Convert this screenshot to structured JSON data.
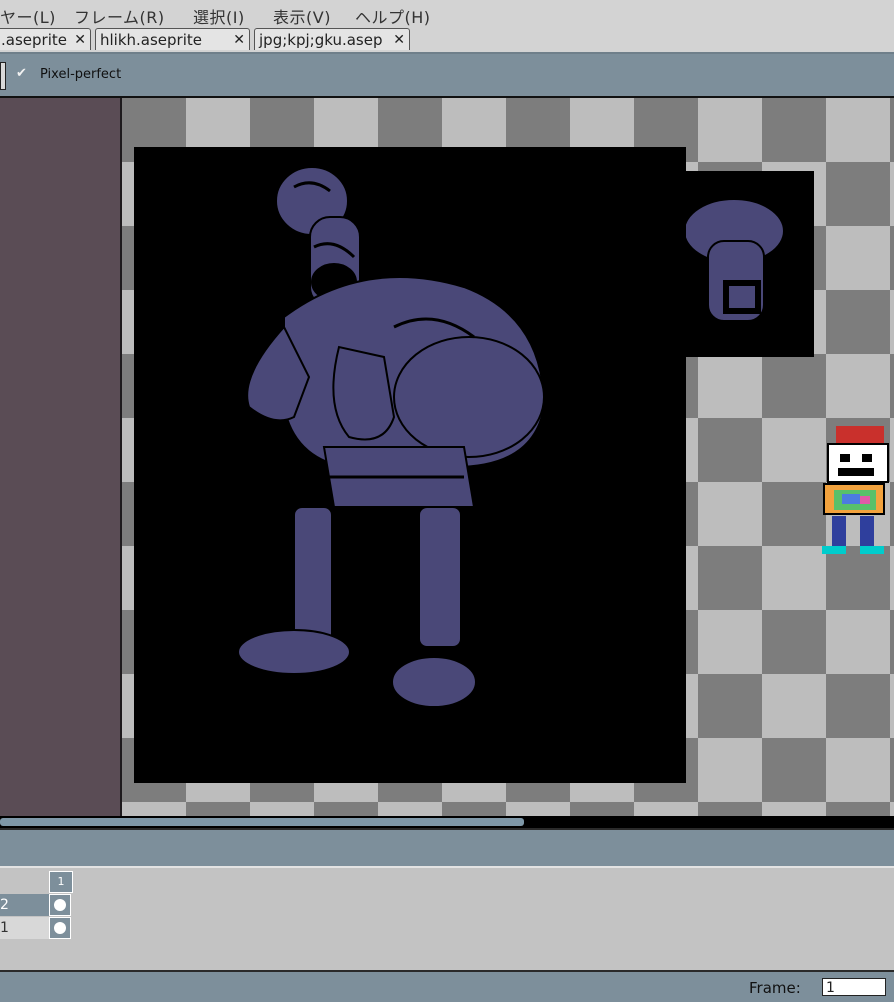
{
  "menubar": {
    "items": [
      "ヤー(L)",
      "フレーム(R)",
      "選択(I)",
      "表示(V)",
      "ヘルプ(H)"
    ]
  },
  "tabs": [
    {
      "label": ".aseprite",
      "close": "✕"
    },
    {
      "label": "hlikh.aseprite",
      "close": "✕"
    },
    {
      "label": "jpg;kpj;gku.asep",
      "close": "✕"
    }
  ],
  "contextbar": {
    "pixel_perfect_label": "Pixel-perfect",
    "pixel_perfect_checked": true
  },
  "timeline": {
    "frame_header": "1",
    "layers": [
      {
        "name": "2",
        "selected": true
      },
      {
        "name": "1",
        "selected": false
      }
    ]
  },
  "statusbar": {
    "frame_label": "Frame:",
    "frame_value": "1"
  },
  "colors": {
    "menubar_bg": "#d3d3d3",
    "panel_blue_gray": "#7d8f9b",
    "sprite_purple": "#4a4878",
    "sprite_bg": "#000000",
    "left_pane": "#5a4c55",
    "checker_dark": "#7d7d7d",
    "checker_light": "#bdbdbd"
  },
  "icons": {
    "tab_close": "close-icon",
    "pixel_perfect_check": "checkmark-icon"
  }
}
